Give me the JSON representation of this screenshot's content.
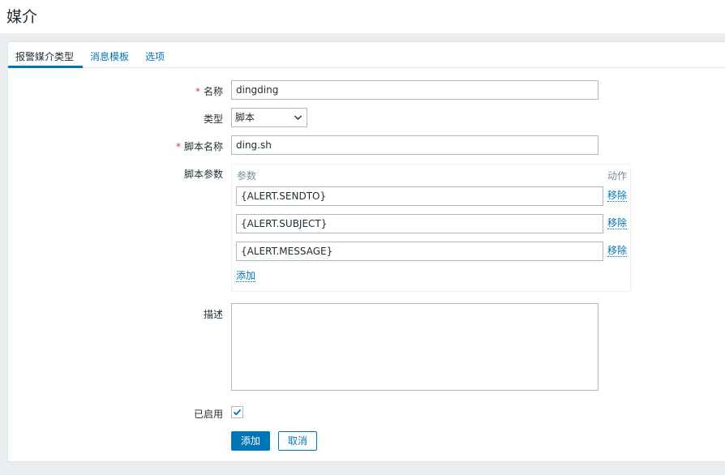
{
  "page": {
    "title": "媒介"
  },
  "tabs": [
    {
      "label": "报警媒介类型",
      "active": true
    },
    {
      "label": "消息模板",
      "active": false
    },
    {
      "label": "选项",
      "active": false
    }
  ],
  "form": {
    "name": {
      "label": "名称",
      "required": true,
      "value": "dingding"
    },
    "type": {
      "label": "类型",
      "value": "脚本"
    },
    "script_name": {
      "label": "脚本名称",
      "required": true,
      "value": "ding.sh"
    },
    "script_params": {
      "label": "脚本参数",
      "col_param": "参数",
      "col_action": "动作",
      "rows": [
        {
          "value": "{ALERT.SENDTO}",
          "remove_label": "移除"
        },
        {
          "value": "{ALERT.SUBJECT}",
          "remove_label": "移除"
        },
        {
          "value": "{ALERT.MESSAGE}",
          "remove_label": "移除"
        }
      ],
      "add_label": "添加"
    },
    "description": {
      "label": "描述",
      "value": ""
    },
    "enabled": {
      "label": "已启用",
      "checked": true
    }
  },
  "buttons": {
    "submit": "添加",
    "cancel": "取消"
  },
  "colors": {
    "accent": "#0275b8",
    "required": "#e33734",
    "background": "#ebeef0"
  },
  "icons": {
    "select_arrow": "chevron-down-icon",
    "check": "checkmark-icon",
    "resize": "resize-grip-icon"
  }
}
